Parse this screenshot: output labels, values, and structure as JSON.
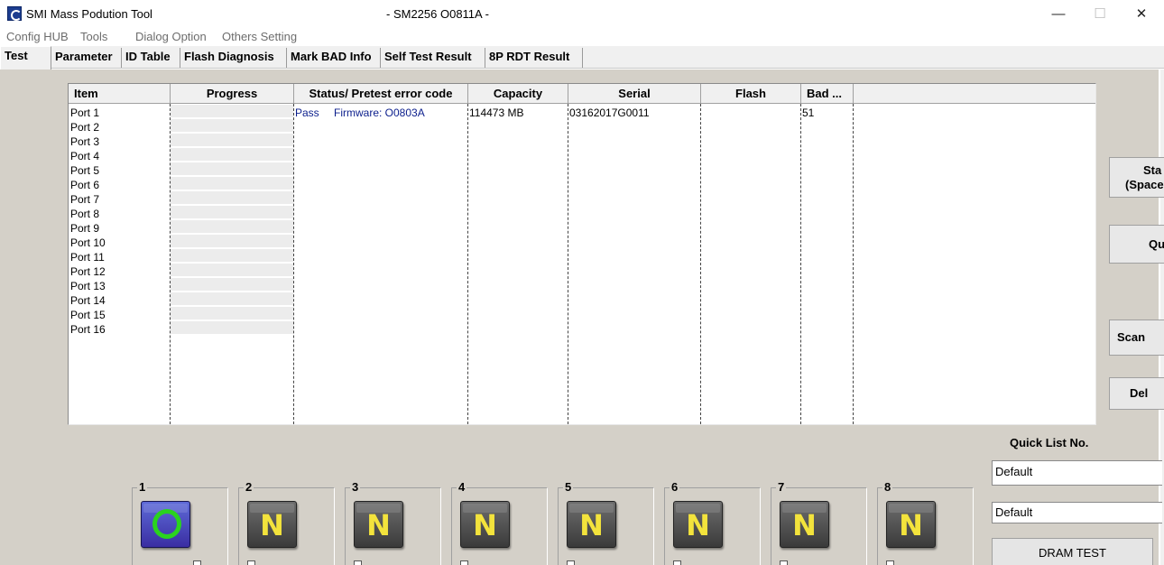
{
  "window": {
    "title": "SMI Mass Podution Tool",
    "subtitle": "- SM2256 O0811A -",
    "minimize": "—",
    "maximize": "☐",
    "close": "✕"
  },
  "menu": [
    "Config HUB",
    "Tools\u0001",
    "Dialog Option",
    "Others Setting"
  ],
  "tabs": [
    "Test",
    "Parameter",
    "ID Table",
    "Flash Diagnosis",
    "Mark BAD Info",
    "Self Test Result",
    "8P RDT Result"
  ],
  "table": {
    "columns": [
      "Item",
      "Progress",
      "Status/ Pretest error code",
      "Capacity",
      "Serial",
      "Flash",
      "Bad ..."
    ],
    "rows": [
      "Port 1",
      "Port 2",
      "Port 3",
      "Port 4",
      "Port 5",
      "Port 6",
      "Port 7",
      "Port 8",
      "Port 9",
      "Port 10",
      "Port 11",
      "Port 12",
      "Port 13",
      "Port 14",
      "Port 15",
      "Port 16"
    ],
    "row1": {
      "status": "Pass",
      "firmware": "Firmware: O0803A",
      "capacity": "114473 MB",
      "serial": "03162017G0011",
      "bad": "51"
    }
  },
  "side_buttons": {
    "start_line1": "Sta",
    "start_line2": "(Space",
    "quit": "Qu",
    "scan": "Scan",
    "delete": "Del"
  },
  "quick_list": {
    "label": "Quick List No.",
    "field1": "Default",
    "field2": "Default"
  },
  "dram_test": "DRAM TEST",
  "ports": [
    {
      "num": "1",
      "glyph": "",
      "state": "active"
    },
    {
      "num": "2",
      "glyph": "N",
      "state": "idle"
    },
    {
      "num": "3",
      "glyph": "N",
      "state": "idle"
    },
    {
      "num": "4",
      "glyph": "N",
      "state": "idle"
    },
    {
      "num": "5",
      "glyph": "N",
      "state": "idle"
    },
    {
      "num": "6",
      "glyph": "N",
      "state": "idle"
    },
    {
      "num": "7",
      "glyph": "N",
      "state": "idle"
    },
    {
      "num": "8",
      "glyph": "N",
      "state": "idle"
    }
  ]
}
